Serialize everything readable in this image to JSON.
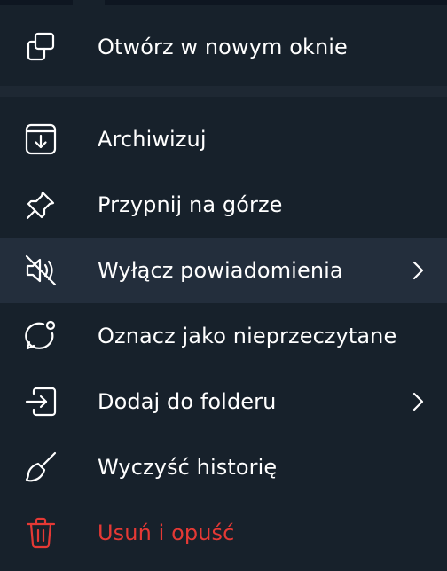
{
  "menu": {
    "items": [
      {
        "label": "Otwórz w nowym oknie",
        "icon": "new-window-icon"
      },
      {
        "label": "Archiwizuj",
        "icon": "archive-icon"
      },
      {
        "label": "Przypnij na górze",
        "icon": "pin-icon"
      },
      {
        "label": "Wyłącz powiadomienia",
        "icon": "mute-icon",
        "submenu": true,
        "highlighted": true
      },
      {
        "label": "Oznacz jako nieprzeczytane",
        "icon": "mark-unread-icon"
      },
      {
        "label": "Dodaj do folderu",
        "icon": "add-to-folder-icon",
        "submenu": true
      },
      {
        "label": "Wyczyść historię",
        "icon": "clear-history-icon"
      },
      {
        "label": "Usuń i opuść",
        "icon": "trash-icon",
        "danger": true
      }
    ]
  },
  "colors": {
    "background": "#17212b",
    "highlight": "#232e3c",
    "text": "#ffffff",
    "danger": "#e53935"
  }
}
